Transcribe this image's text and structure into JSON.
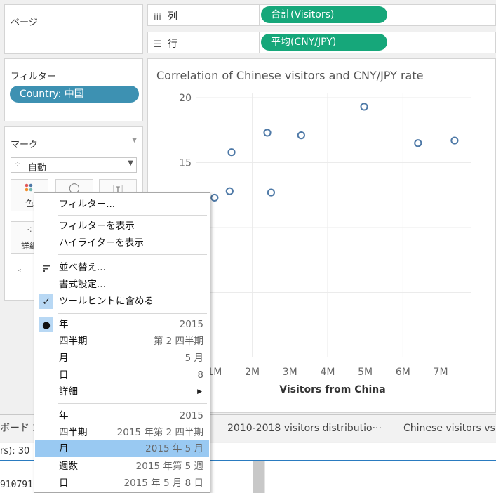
{
  "pages": {
    "title": "ページ"
  },
  "filters": {
    "title": "フィルター",
    "pill": "Country: 中国",
    "pill_color": "#3d91b2"
  },
  "marks": {
    "title": "マーク",
    "type": "自動",
    "buttons": [
      "色",
      "詳細"
    ]
  },
  "shelves": {
    "columns_label": "列",
    "columns_pill": "合計(Visitors)",
    "rows_label": "行",
    "rows_pill": "平均(CNY/JPY)",
    "pill_color": "#16a77a"
  },
  "chart_data": {
    "type": "scatter",
    "title": "Correlation of Chinese visitors and CNY/JPY rate",
    "xlabel": "Visitors from China",
    "x_ticks": [
      "1M",
      "2M",
      "3M",
      "4M",
      "5M",
      "6M",
      "7M"
    ],
    "y_ticks": [
      "20",
      "15"
    ],
    "xlim": [
      0.5,
      7.8
    ],
    "ylim": [
      0,
      20
    ],
    "grid": true,
    "marker_color": "#4e79a7",
    "points": [
      {
        "x": 1.0,
        "y": 12.3
      },
      {
        "x": 1.4,
        "y": 12.8
      },
      {
        "x": 1.45,
        "y": 15.8
      },
      {
        "x": 2.4,
        "y": 17.3
      },
      {
        "x": 2.5,
        "y": 12.7
      },
      {
        "x": 3.3,
        "y": 17.1
      },
      {
        "x": 4.97,
        "y": 19.3
      },
      {
        "x": 6.4,
        "y": 16.5
      },
      {
        "x": 7.37,
        "y": 16.7
      }
    ]
  },
  "context_menu": {
    "items_top": [
      "フィルター...",
      "フィルターを表示",
      "ハイライターを表示",
      "並べ替え...",
      "書式設定...",
      "ツールヒントに含める"
    ],
    "discrete": [
      {
        "label": "年",
        "value": "2015"
      },
      {
        "label": "四半期",
        "value": "第 2 四半期"
      },
      {
        "label": "月",
        "value": "5 月"
      },
      {
        "label": "日",
        "value": "8"
      },
      {
        "label": "詳細",
        "value": ""
      }
    ],
    "continuous": [
      {
        "label": "年",
        "value": "2015"
      },
      {
        "label": "四半期",
        "value": "2015 年第 2 四半期"
      },
      {
        "label": "月",
        "value": "2015 年 5 月"
      },
      {
        "label": "週数",
        "value": "2015 年第 5 週"
      },
      {
        "label": "日",
        "value": "2015 年 5 月 8 日"
      }
    ],
    "selection_color": "#99c9f2"
  },
  "tabs": [
    "ボード 2",
    "2010-2018 visitors distributio···",
    "Chinese visitors vs"
  ],
  "status": {
    "text": "rs): 30",
    "number": "910791"
  }
}
